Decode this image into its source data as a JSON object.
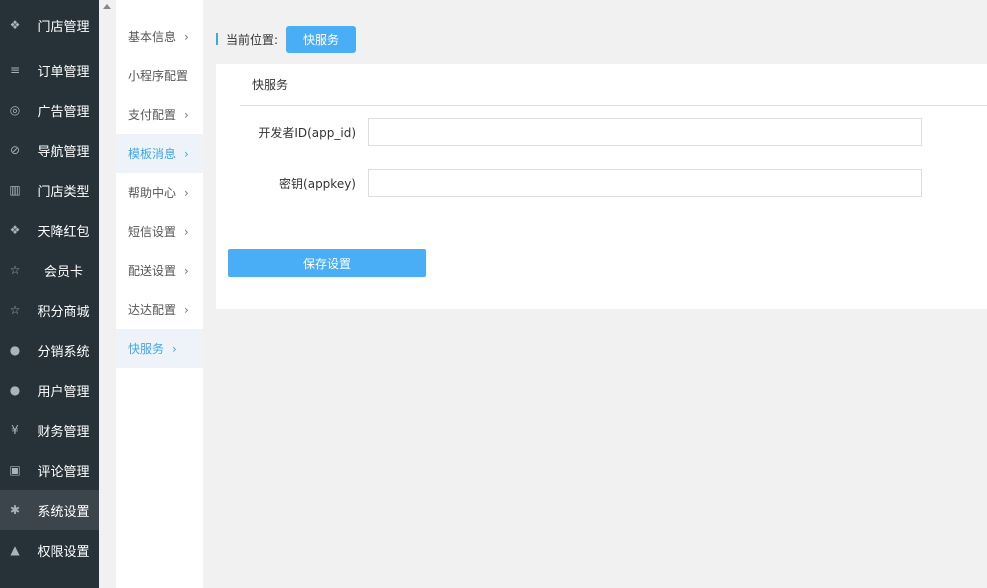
{
  "nav": {
    "items": [
      {
        "icon": "cubes-icon",
        "glyph": "❖",
        "label": "门店管理"
      },
      {
        "icon": "list-icon",
        "glyph": "≡",
        "label": "订单管理"
      },
      {
        "icon": "lifebuoy-icon",
        "glyph": "◎",
        "label": "广告管理"
      },
      {
        "icon": "compass-icon",
        "glyph": "⊘",
        "label": "导航管理"
      },
      {
        "icon": "bank-icon",
        "glyph": "▥",
        "label": "门店类型"
      },
      {
        "icon": "cubes-icon",
        "glyph": "❖",
        "label": "天降红包"
      },
      {
        "icon": "star-icon",
        "glyph": "☆",
        "label": "会员卡"
      },
      {
        "icon": "star-icon",
        "glyph": "☆",
        "label": "积分商城"
      },
      {
        "icon": "users-icon",
        "glyph": "●",
        "label": "分销系统"
      },
      {
        "icon": "user-icon",
        "glyph": "●",
        "label": "用户管理"
      },
      {
        "icon": "yen-icon",
        "glyph": "¥",
        "label": "财务管理"
      },
      {
        "icon": "money-icon",
        "glyph": "▣",
        "label": "评论管理"
      },
      {
        "icon": "gear-icon",
        "glyph": "✱",
        "label": "系统设置"
      },
      {
        "icon": "lock-icon",
        "glyph": "▲",
        "label": "权限设置"
      }
    ],
    "active_index": 12
  },
  "subnav": {
    "items": [
      {
        "label": "基本信息",
        "chevron": "›"
      },
      {
        "label": "小程序配置",
        "chevron": ""
      },
      {
        "label": "支付配置",
        "chevron": "›"
      },
      {
        "label": "模板消息",
        "chevron": "›"
      },
      {
        "label": "帮助中心",
        "chevron": "›"
      },
      {
        "label": "短信设置",
        "chevron": "›"
      },
      {
        "label": "配送设置",
        "chevron": "›"
      },
      {
        "label": "达达配置",
        "chevron": "›"
      },
      {
        "label": "快服务",
        "chevron": "›"
      }
    ],
    "highlighted": [
      3,
      8
    ]
  },
  "breadcrumb": {
    "label": "当前位置:",
    "current": "快服务"
  },
  "panel": {
    "title": "快服务",
    "fields": [
      {
        "label": "开发者ID(app_id)",
        "value": ""
      },
      {
        "label": "密钥(appkey)",
        "value": ""
      }
    ],
    "save_label": "保存设置"
  },
  "colors": {
    "accent": "#49aef5",
    "nav_bg": "#263238",
    "nav_active": "#3b454b"
  }
}
